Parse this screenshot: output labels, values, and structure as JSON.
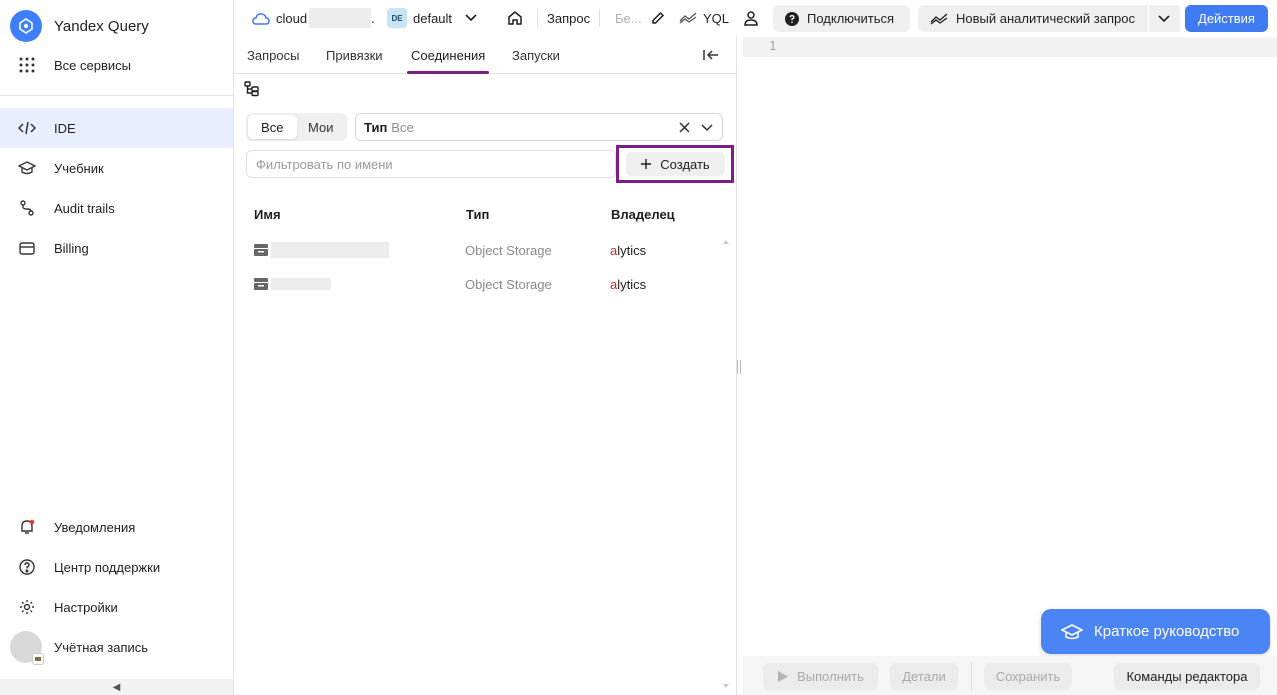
{
  "sidebar": {
    "brand_title": "Yandex Query",
    "all_services": "Все сервисы",
    "items": [
      {
        "label": "IDE"
      },
      {
        "label": "Учебник"
      },
      {
        "label": "Audit trails"
      },
      {
        "label": "Billing"
      }
    ],
    "bottom_items": [
      {
        "label": "Уведомления"
      },
      {
        "label": "Центр поддержки"
      },
      {
        "label": "Настройки"
      },
      {
        "label": "Учётная запись"
      }
    ],
    "collapse_glyph": "◀"
  },
  "topbar": {
    "cloud_label": "cloud",
    "cloud_suffix": ".",
    "folder_badge": "DE",
    "folder_name": "default",
    "query_label": "Запрос",
    "query_name": "Бе...",
    "lang_label": "YQL",
    "connect_label": "Подключиться",
    "new_query_label": "Новый аналитический запрос",
    "actions_label": "Действия"
  },
  "panel": {
    "tabs": [
      {
        "label": "Запросы"
      },
      {
        "label": "Привязки"
      },
      {
        "label": "Соединения"
      },
      {
        "label": "Запуски"
      }
    ],
    "segment": {
      "all": "Все",
      "mine": "Мои"
    },
    "type_filter": {
      "label": "Тип",
      "value": "Все"
    },
    "filter_placeholder": "Фильтровать по имени",
    "create_label": "Создать",
    "columns": [
      "Имя",
      "Тип",
      "Владелец"
    ],
    "rows": [
      {
        "type": "Object Storage",
        "owner_prefix": "a",
        "owner_rest": "lytics"
      },
      {
        "type": "Object Storage",
        "owner_prefix": "a",
        "owner_rest": "lytics"
      }
    ]
  },
  "editor": {
    "line_number": "1",
    "buttons": {
      "run": "Выполнить",
      "details": "Детали",
      "save": "Сохранить",
      "commands": "Команды редактора"
    },
    "guide_label": "Краткое руководство"
  },
  "colors": {
    "accent": "#3f7cf4",
    "active_tab_underline": "#7b1e8c",
    "highlight_frame": "#7b1e8c",
    "owner_prefix": "#d4262f"
  }
}
